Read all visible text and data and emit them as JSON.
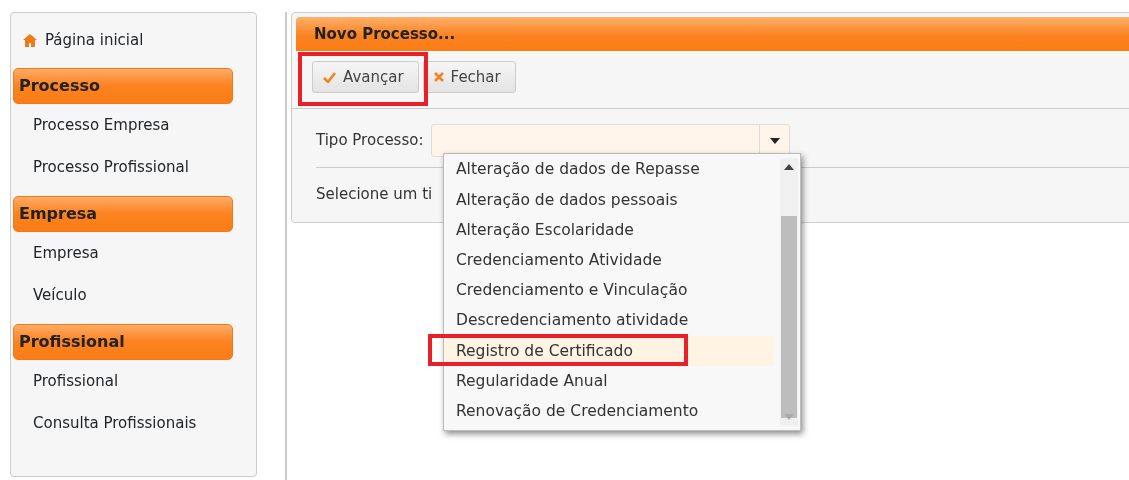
{
  "sidebar": {
    "home": {
      "label": "Página inicial"
    },
    "groups": [
      {
        "title": "Processo",
        "items": [
          {
            "label": "Processo Empresa"
          },
          {
            "label": "Processo Profissional"
          }
        ]
      },
      {
        "title": "Empresa",
        "items": [
          {
            "label": "Empresa"
          },
          {
            "label": "Veículo"
          }
        ]
      },
      {
        "title": "Profissional",
        "items": [
          {
            "label": "Profissional"
          },
          {
            "label": "Consulta Profissionais"
          }
        ]
      }
    ]
  },
  "panel": {
    "title": "Novo Processo...",
    "toolbar": [
      {
        "kind": "check",
        "label": "Avançar",
        "annotated": true
      },
      {
        "kind": "close",
        "label": "Fechar",
        "annotated": false
      }
    ],
    "field": {
      "label": "Tipo Processo:"
    },
    "hint": "Selecione um ti",
    "dropdown": {
      "options": [
        {
          "label": "Alteração de dados de Repasse",
          "selected": false,
          "annotated": false
        },
        {
          "label": "Alteração de dados pessoais",
          "selected": false,
          "annotated": false
        },
        {
          "label": "Alteração Escolaridade",
          "selected": false,
          "annotated": false
        },
        {
          "label": "Credenciamento Atividade",
          "selected": false,
          "annotated": false
        },
        {
          "label": "Credenciamento e Vinculação",
          "selected": false,
          "annotated": false
        },
        {
          "label": "Descredenciamento atividade",
          "selected": false,
          "annotated": false
        },
        {
          "label": "Registro de Certificado",
          "selected": true,
          "annotated": true
        },
        {
          "label": "Regularidade Anual",
          "selected": false,
          "annotated": false
        },
        {
          "label": "Renovação de Credenciamento",
          "selected": false,
          "annotated": false
        }
      ]
    }
  }
}
